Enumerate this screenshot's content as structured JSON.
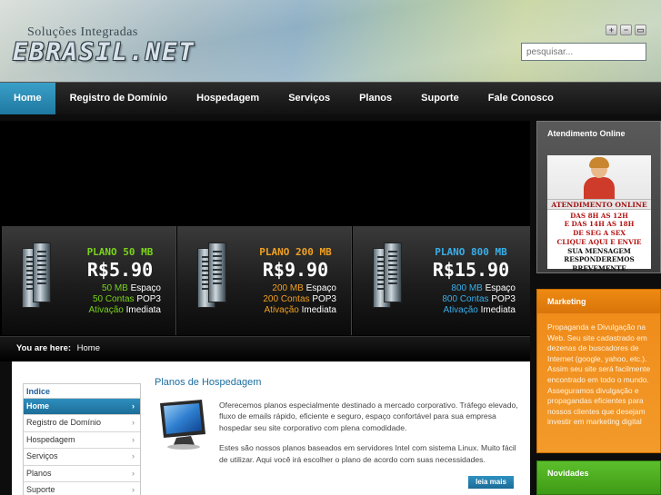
{
  "header": {
    "tagline": "Soluções Integradas",
    "logo": "EBRASIL.NET",
    "search_placeholder": "pesquisar...",
    "window_buttons": [
      "+",
      "−",
      "▭"
    ]
  },
  "nav": {
    "items": [
      "Home",
      "Registro de Domínio",
      "Hospedagem",
      "Serviços",
      "Planos",
      "Suporte",
      "Fale Conosco"
    ],
    "active": "Home"
  },
  "banner": {
    "plans": [
      {
        "name": "PLANO 50 MB",
        "price": "R$5.90",
        "space_a": "50 MB",
        "space_b": "Espaço",
        "accounts_a": "50 Contas",
        "accounts_b": "POP3",
        "act_a": "Ativação",
        "act_b": "Imediata",
        "name_color": "#7ad31a",
        "accent": "#7ad31a"
      },
      {
        "name": "PLANO 200 MB",
        "price": "R$9.90",
        "space_a": "200 MB",
        "space_b": "Espaço",
        "accounts_a": "200 Contas",
        "accounts_b": "POP3",
        "act_a": "Ativação",
        "act_b": "Imediata",
        "name_color": "#f0a020",
        "accent": "#f0a020"
      },
      {
        "name": "PLANO 800 MB",
        "price": "R$15.90",
        "space_a": "800 MB",
        "space_b": "Espaço",
        "accounts_a": "800 Contas",
        "accounts_b": "POP3",
        "act_a": "Ativação",
        "act_b": "Imediata",
        "name_color": "#3aaee8",
        "accent": "#3aaee8"
      }
    ]
  },
  "breadcrumb": {
    "label": "You are here:",
    "current": "Home"
  },
  "indice": {
    "title": "Indice",
    "items": [
      "Home",
      "Registro de Domínio",
      "Hospedagem",
      "Serviços",
      "Planos",
      "Suporte"
    ]
  },
  "main": {
    "title": "Planos de Hospedagem",
    "para1": "Oferecemos planos especialmente destinado a mercado corporativo. Tráfego elevado, fluxo de emails rápido, eficiente e seguro, espaço confortável para sua empresa hospedar seu site corporativo com plena comodidade.",
    "para2": "Estes são nossos planos baseados em servidores Intel com sistema Linux. Muito fácil de utilizar. Aqui você irá escolher o plano de acordo com suas necessidades.",
    "more": "leia mais"
  },
  "sidebar": {
    "atendimento": {
      "title": "Atendimento Online",
      "band": "ATENDIMENTO ONLINE",
      "hours1": "DAS 8H AS 12H",
      "hours2": "E DAS 14H AS 18H",
      "days": "DE SEG A SEX",
      "cta1": "CLIQUE AQUI E ENVIE",
      "cta2": "SUA MENSAGEM",
      "cta3": "RESPONDEREMOS",
      "cta4": "BREVEMENTE"
    },
    "marketing": {
      "title": "Marketing",
      "text": "Propaganda e Divulgação na Web. Seu site cadastrado em dezenas de buscadores de Internet (google, yahoo, etc.). Assim seu site será facilmente encontrado em todo o mundo. Asseguramos divulgação e propagandas eficientes para nossos clientes que desejam investir em marketing digital"
    },
    "novidades": {
      "title": "Novidades"
    }
  }
}
